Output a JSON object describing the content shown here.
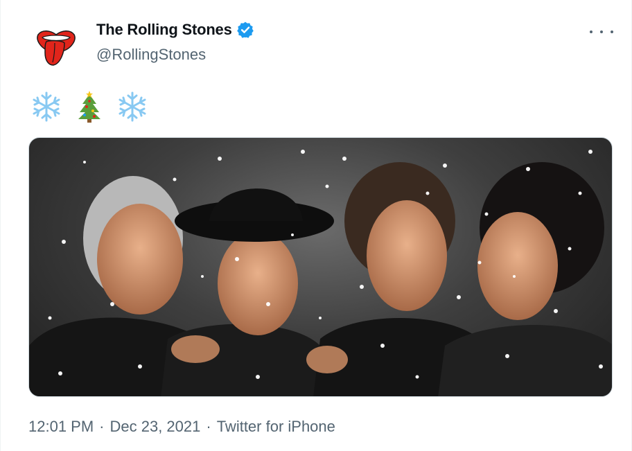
{
  "tweet": {
    "author": {
      "display_name": "The Rolling Stones",
      "handle": "@RollingStones",
      "verified": true,
      "avatar_icon": "rolling-stones-tongue-logo"
    },
    "text_emojis": [
      "❄️",
      "🎄",
      "❄️"
    ],
    "media": {
      "type": "image",
      "description_icon": "band-photo-with-snow"
    },
    "meta": {
      "time": "12:01 PM",
      "separator": "·",
      "date": "Dec 23, 2021",
      "source": "Twitter for iPhone"
    }
  },
  "colors": {
    "text_primary": "#0f1419",
    "text_secondary": "#536471",
    "verified_blue": "#1d9bf0",
    "logo_red": "#e1251b"
  }
}
